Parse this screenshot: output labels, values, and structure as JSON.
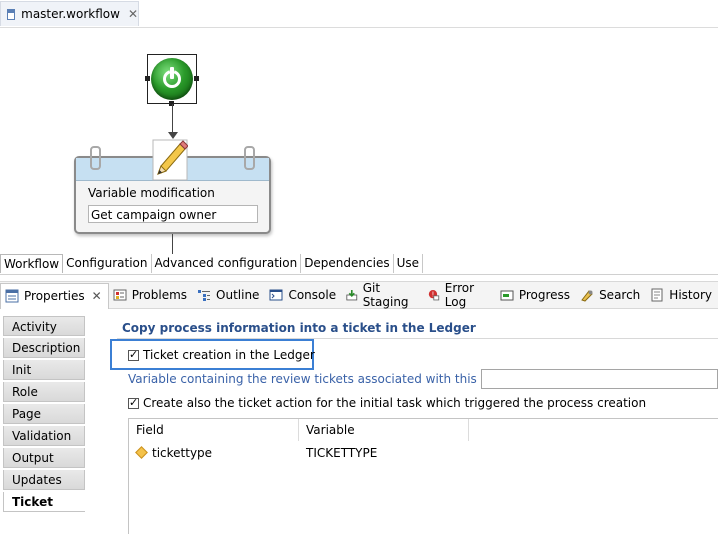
{
  "editor": {
    "tab_title": "master.workflow"
  },
  "diagram": {
    "task_title": "Variable modification",
    "task_value": "Get campaign owner"
  },
  "workflow_tabs": [
    "Workflow",
    "Configuration",
    "Advanced configuration",
    "Dependencies",
    "Use"
  ],
  "views": [
    {
      "label": "Properties",
      "icon": "properties-icon"
    },
    {
      "label": "Problems",
      "icon": "problems-icon"
    },
    {
      "label": "Outline",
      "icon": "outline-icon"
    },
    {
      "label": "Console",
      "icon": "console-icon"
    },
    {
      "label": "Git Staging",
      "icon": "git-staging-icon"
    },
    {
      "label": "Error Log",
      "icon": "error-log-icon"
    },
    {
      "label": "Progress",
      "icon": "progress-icon"
    },
    {
      "label": "Search",
      "icon": "search-icon"
    },
    {
      "label": "History",
      "icon": "history-icon"
    }
  ],
  "sidebar": {
    "items": [
      "Activity",
      "Description",
      "Init",
      "Role",
      "Page",
      "Validation",
      "Output",
      "Updates",
      "Ticket"
    ],
    "active": "Ticket"
  },
  "ticket": {
    "section_title": "Copy process information into a ticket in the Ledger",
    "ticket_creation_label": "Ticket creation in the Ledger",
    "ticket_creation_checked": true,
    "variable_label": "Variable containing the review tickets associated with this process",
    "variable_value": "",
    "create_action_label": "Create also the ticket action for the initial task which triggered the process creation",
    "create_action_checked": true,
    "table": {
      "columns": [
        "Field",
        "Variable"
      ],
      "rows": [
        {
          "field": "tickettype",
          "variable": "TICKETTYPE"
        }
      ]
    }
  }
}
